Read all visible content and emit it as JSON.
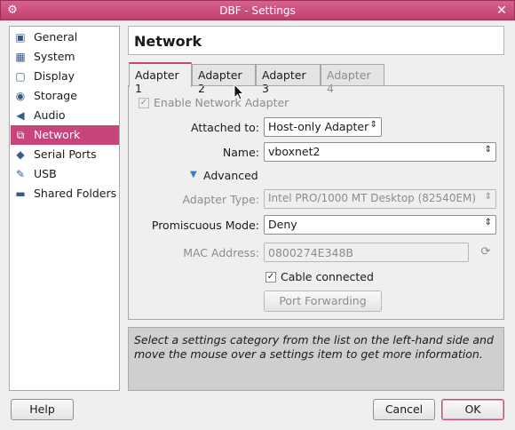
{
  "window": {
    "title": "DBF - Settings"
  },
  "sidebar": {
    "items": [
      {
        "label": "General",
        "icon": "general-icon"
      },
      {
        "label": "System",
        "icon": "system-icon"
      },
      {
        "label": "Display",
        "icon": "display-icon"
      },
      {
        "label": "Storage",
        "icon": "storage-icon"
      },
      {
        "label": "Audio",
        "icon": "audio-icon"
      },
      {
        "label": "Network",
        "icon": "network-icon",
        "selected": true
      },
      {
        "label": "Serial Ports",
        "icon": "serial-ports-icon"
      },
      {
        "label": "USB",
        "icon": "usb-icon"
      },
      {
        "label": "Shared Folders",
        "icon": "shared-folders-icon"
      }
    ]
  },
  "page": {
    "title": "Network"
  },
  "tabs": [
    {
      "label": "Adapter 1",
      "active": true
    },
    {
      "label": "Adapter 2"
    },
    {
      "label": "Adapter 3"
    },
    {
      "label": "Adapter 4",
      "disabled": true
    }
  ],
  "adapter": {
    "enable_label": "Enable Network Adapter",
    "enable_checked": true,
    "attached_label": "Attached to:",
    "attached_value": "Host-only Adapter",
    "name_label": "Name:",
    "name_value": "vboxnet2",
    "advanced_label": "Advanced",
    "adapter_type_label": "Adapter Type:",
    "adapter_type_value": "Intel PRO/1000 MT Desktop (82540EM)",
    "promiscuous_label": "Promiscuous Mode:",
    "promiscuous_value": "Deny",
    "mac_label": "MAC Address:",
    "mac_value": "0800274E348B",
    "cable_label": "Cable connected",
    "cable_checked": true,
    "port_forwarding_label": "Port Forwarding"
  },
  "info": {
    "line1": "Select a settings category from the list on the left-hand side and",
    "line2": "move the mouse over a settings item to get more information."
  },
  "buttons": {
    "help": "Help",
    "cancel": "Cancel",
    "ok": "OK"
  },
  "colors": {
    "accent": "#c8457a",
    "titlebar": "#d05585"
  }
}
